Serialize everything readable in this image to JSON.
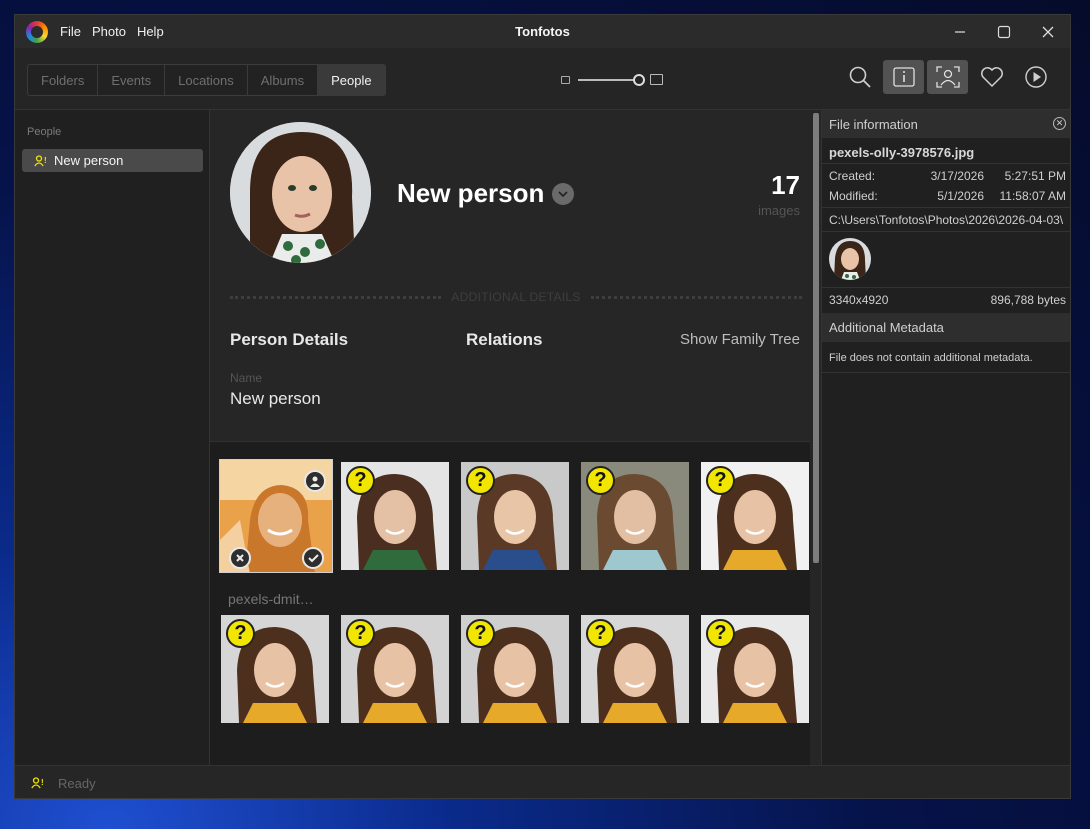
{
  "app": {
    "title": "Tonfotos",
    "menu": [
      "File",
      "Photo",
      "Help"
    ]
  },
  "toolbar": {
    "tabs": [
      "Folders",
      "Events",
      "Locations",
      "Albums",
      "People"
    ],
    "active_tab": "People",
    "zoom_level": 0.9,
    "tools": [
      "search-icon",
      "info-icon",
      "face-recognition-icon",
      "heart-icon",
      "play-icon"
    ]
  },
  "sidebar": {
    "header": "People",
    "items": [
      {
        "label": "New person",
        "selected": true
      }
    ]
  },
  "person": {
    "name": "New person",
    "image_count": "17",
    "image_count_label": "images",
    "divider_label": "ADDITIONAL DETAILS",
    "details_header": "Person Details",
    "relations_header": "Relations",
    "family_tree_link": "Show Family Tree",
    "field_name_label": "Name",
    "field_name_value": "New person"
  },
  "gallery": {
    "selected_caption": "pexels-dmit…",
    "items": [
      {
        "status": "selected"
      },
      {
        "status": "unconfirmed"
      },
      {
        "status": "unconfirmed"
      },
      {
        "status": "unconfirmed"
      },
      {
        "status": "unconfirmed"
      },
      {
        "status": "unconfirmed"
      },
      {
        "status": "unconfirmed"
      },
      {
        "status": "unconfirmed"
      },
      {
        "status": "unconfirmed"
      },
      {
        "status": "unconfirmed"
      }
    ]
  },
  "file_info": {
    "header": "File information",
    "filename": "pexels-olly-3978576.jpg",
    "created_label": "Created:",
    "created_date": "3/17/2026",
    "created_time": "5:27:51 PM",
    "modified_label": "Modified:",
    "modified_date": "5/1/2026",
    "modified_time": "11:58:07 AM",
    "path": "C:\\Users\\Tonfotos\\Photos\\2026\\2026-04-03\\",
    "dimensions": "3340x4920",
    "size": "896,788 bytes",
    "metadata_header": "Additional Metadata",
    "metadata_text": "File does not contain additional metadata."
  },
  "status": {
    "text": "Ready"
  },
  "colors": {
    "accent_yellow": "#f2e600",
    "background": "#202020"
  }
}
